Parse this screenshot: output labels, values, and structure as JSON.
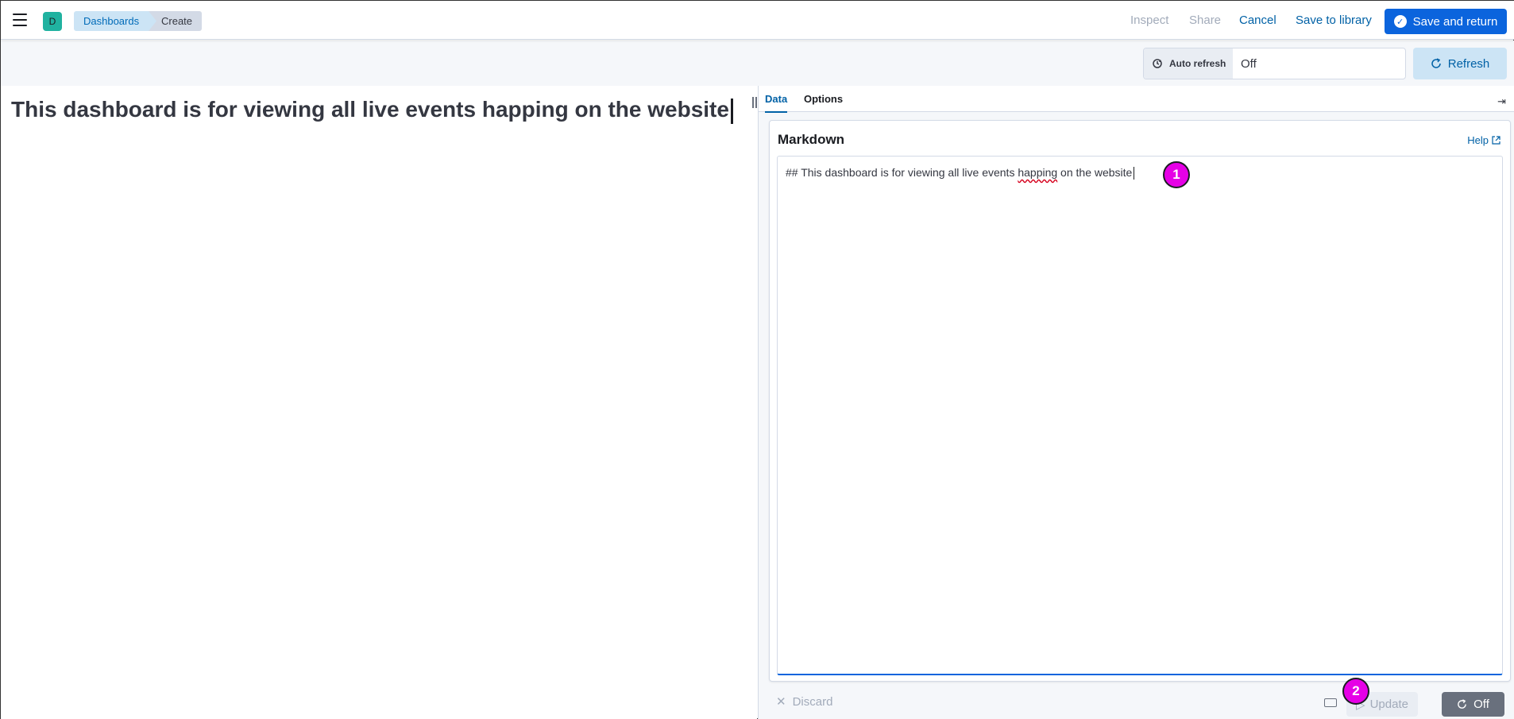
{
  "header": {
    "avatar_letter": "D",
    "breadcrumbs": [
      "Dashboards",
      "Create"
    ],
    "inspect_label": "Inspect",
    "share_label": "Share",
    "cancel_label": "Cancel",
    "save_library_label": "Save to library",
    "save_return_label": "Save and return"
  },
  "toolbar": {
    "auto_refresh_label": "Auto refresh",
    "auto_refresh_value": "Off",
    "refresh_label": "Refresh"
  },
  "preview": {
    "heading": "This dashboard is for viewing all live events happing on the website"
  },
  "editor": {
    "tabs": [
      "Data",
      "Options"
    ],
    "selected_tab": "Data",
    "panel_title": "Markdown",
    "help_label": "Help",
    "markdown_prefix": "## This dashboard is for viewing all live events ",
    "markdown_misspelled": "happing",
    "markdown_suffix": " on the website",
    "discard_label": "Discard",
    "update_label": "Update",
    "auto_apply_label": "Off"
  },
  "markers": [
    "1",
    "2"
  ],
  "colors": {
    "primary": "#0b64dd",
    "link": "#0061a6",
    "avatar": "#20b2a0",
    "marker": "#e600e6"
  },
  "icons": [
    "menu-icon",
    "auto-refresh-icon",
    "refresh-icon",
    "check-circle-icon",
    "external-link-icon",
    "collapse-panel-icon",
    "close-icon",
    "keyboard-icon",
    "play-icon"
  ]
}
